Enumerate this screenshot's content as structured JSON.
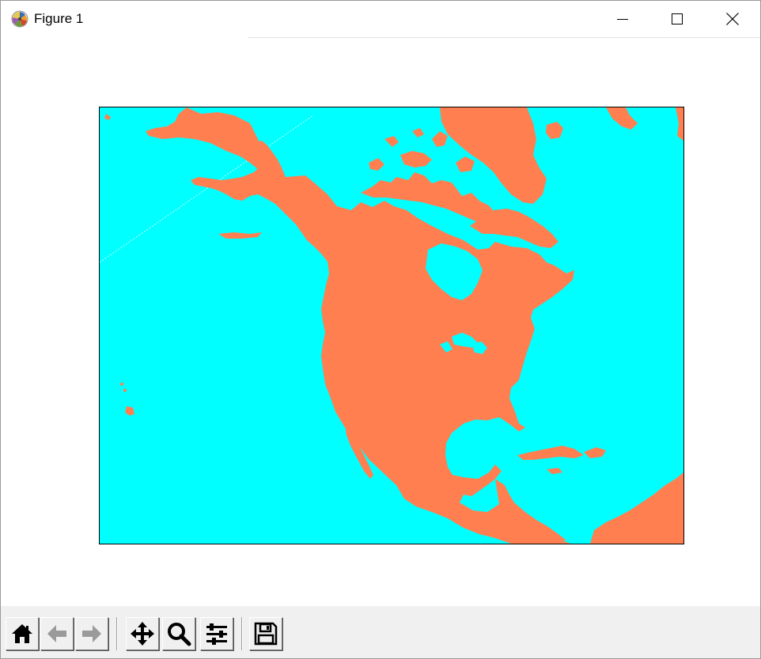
{
  "window": {
    "title": "Figure 1",
    "app_icon": "matplotlib-icon",
    "controls": {
      "minimize": "minimize-icon",
      "maximize": "maximize-icon",
      "close": "close-icon"
    }
  },
  "map": {
    "ocean_color": "#00ffff",
    "land_color": "#ff7f50",
    "frame_color": "#000000"
  },
  "toolbar": {
    "buttons": [
      {
        "icon": "home-icon",
        "enabled": true
      },
      {
        "icon": "back-arrow-icon",
        "enabled": false
      },
      {
        "icon": "forward-arrow-icon",
        "enabled": false
      },
      {
        "icon": "pan-move-icon",
        "enabled": true
      },
      {
        "icon": "zoom-magnifier-icon",
        "enabled": true
      },
      {
        "icon": "configure-subplots-icon",
        "enabled": true
      },
      {
        "icon": "save-floppy-icon",
        "enabled": true
      }
    ]
  }
}
